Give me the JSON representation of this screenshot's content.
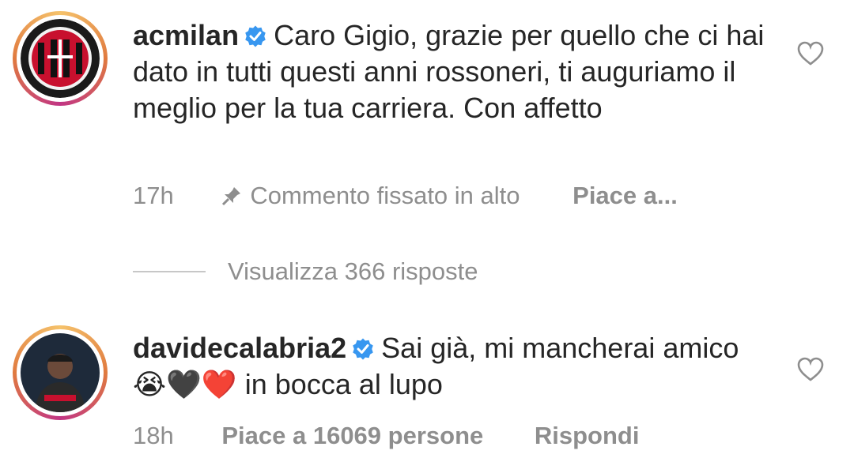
{
  "comments": [
    {
      "username": "acmilan",
      "text": "Caro Gigio, grazie per quello che ci hai dato in tutti questi anni rossoneri, ti auguriamo il meglio per la tua carriera. Con affetto",
      "time": "17h",
      "pinned_label": "Commento fissato in alto",
      "likes_label": "Piace a..."
    },
    {
      "username": "davidecalabria2",
      "text_before": "Sai già, mi mancherai amico",
      "emojis": [
        "😭",
        "🖤",
        "❤️"
      ],
      "text_after": "in bocca al lupo",
      "time": "18h",
      "likes_label": "Piace a 16069 persone",
      "reply_label": "Rispondi"
    }
  ],
  "view_replies_label": "Visualizza 366 risposte",
  "colors": {
    "text": "#262626",
    "meta": "#8e8e8e",
    "verified": "#3897f0",
    "milan_red": "#d62b2b"
  },
  "icons": [
    "verified-badge-icon",
    "heart-outline-icon",
    "pin-icon"
  ]
}
